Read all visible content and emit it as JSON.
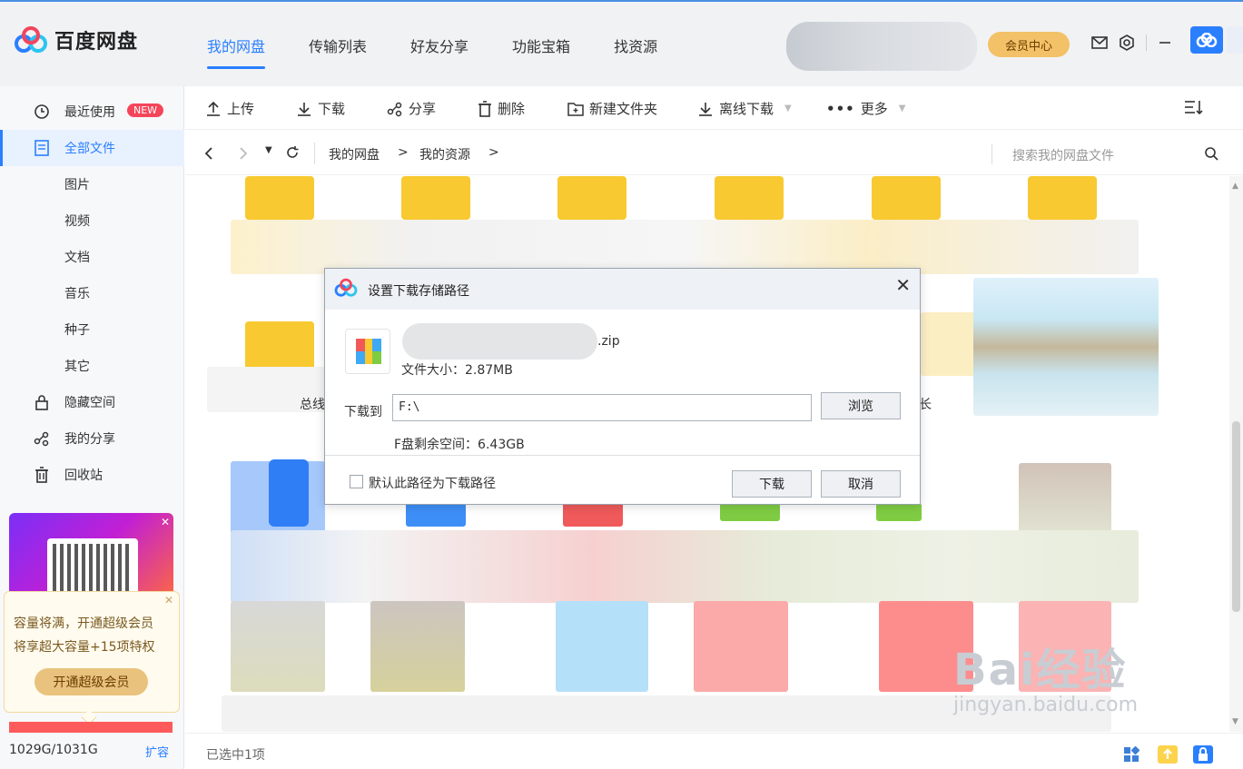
{
  "app": {
    "name": "百度网盘"
  },
  "nav": {
    "tabs": [
      "我的网盘",
      "传输列表",
      "好友分享",
      "功能宝箱",
      "找资源"
    ],
    "active": "我的网盘"
  },
  "header": {
    "vip_label": "会员中心"
  },
  "sidebar": {
    "items": [
      {
        "label": "最近使用",
        "icon": "clock-icon",
        "badge": "NEW"
      },
      {
        "label": "全部文件",
        "icon": "document-icon"
      },
      {
        "label": "图片"
      },
      {
        "label": "视频"
      },
      {
        "label": "文档"
      },
      {
        "label": "音乐"
      },
      {
        "label": "种子"
      },
      {
        "label": "其它"
      },
      {
        "label": "隐藏空间",
        "icon": "lock-icon"
      },
      {
        "label": "我的分享",
        "icon": "share-icon"
      },
      {
        "label": "回收站",
        "icon": "trash-icon"
      }
    ],
    "tip": {
      "line1": "容量将满，开通超级会员",
      "line2": "将享超大容量+15项特权",
      "button": "开通超级会员"
    },
    "quota": {
      "text": "1029G/1031G",
      "expand": "扩容",
      "used_fraction": 0.998
    }
  },
  "toolbar": {
    "upload": "上传",
    "download": "下载",
    "share": "分享",
    "delete": "删除",
    "new_folder": "新建文件夹",
    "offline_download": "离线下载",
    "more": "更多"
  },
  "address": {
    "crumbs": [
      "我的网盘",
      "我的资源"
    ],
    "search_placeholder": "搜索我的网盘文件"
  },
  "content": {
    "partial_label_1": "总线",
    "partial_label_2": "长"
  },
  "status": {
    "selected": "已选中1项"
  },
  "dialog": {
    "title": "设置下载存储路径",
    "file_ext": ".zip",
    "file_size": "文件大小：2.87MB",
    "download_to_label": "下载到",
    "path": "F:\\",
    "browse": "浏览",
    "free_space": "F盘剩余空间：6.43GB",
    "default_checkbox": "默认此路径为下载路径",
    "confirm": "下载",
    "cancel": "取消"
  },
  "watermark": {
    "main": "Bai经验",
    "sub": "jingyan.baidu.com"
  },
  "colors": {
    "accent": "#2a7fff",
    "vip": "#f3c167",
    "badge": "#f5455a",
    "folder": "#f8c930",
    "quota": "#fd5b5b"
  }
}
